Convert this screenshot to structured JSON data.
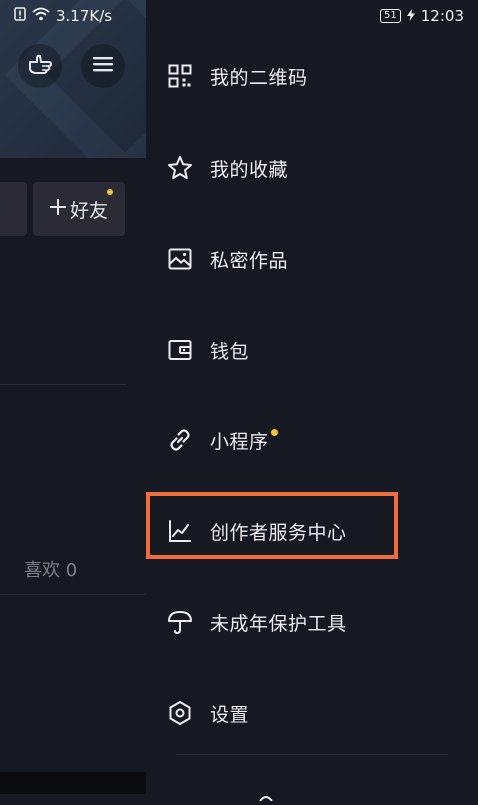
{
  "status_bar": {
    "speed": "3.17K/s",
    "battery": "51",
    "time": "12:03"
  },
  "background": {
    "add_friend_label": "好友",
    "likes_label": "喜欢 0"
  },
  "drawer": {
    "items": [
      {
        "label": "我的二维码",
        "icon": "qr-code-icon"
      },
      {
        "label": "我的收藏",
        "icon": "star-icon"
      },
      {
        "label": "私密作品",
        "icon": "image-icon"
      },
      {
        "label": "钱包",
        "icon": "wallet-icon"
      },
      {
        "label": "小程序",
        "icon": "link-icon",
        "badge": true
      },
      {
        "label": "创作者服务中心",
        "icon": "chart-icon",
        "highlighted": true
      },
      {
        "label": "未成年保护工具",
        "icon": "umbrella-icon"
      },
      {
        "label": "设置",
        "icon": "hexagon-settings-icon"
      }
    ]
  },
  "colors": {
    "background": "#161822",
    "highlight": "#f26b3a",
    "badge": "#f3c23a"
  }
}
